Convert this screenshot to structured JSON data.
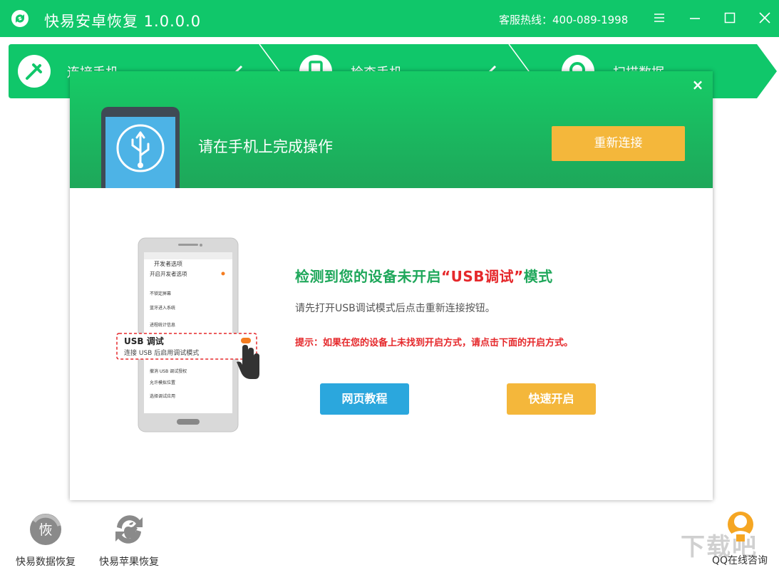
{
  "app": {
    "title": "快易安卓恢复 1.0.0.0",
    "hotline": "客服热线：400-089-1998"
  },
  "colors": {
    "brand_green": "#10c76a",
    "accent_orange": "#f4b73b",
    "accent_blue": "#2ba7dd",
    "alert_red": "#e5282b"
  },
  "window_controls": [
    "menu-icon",
    "minimize-icon",
    "maximize-icon",
    "close-icon"
  ],
  "steps": [
    {
      "label": "连接手机",
      "icon": "plug-icon",
      "done": true
    },
    {
      "label": "检查手机",
      "icon": "phone-icon",
      "done": true
    },
    {
      "label": "扫描数据",
      "icon": "magnifier-icon",
      "done": false
    }
  ],
  "dialog": {
    "close": "×",
    "header_text": "请在手机上完成操作",
    "reconnect_button": "重新连接",
    "title_prefix": "检测到您的设备未开启",
    "title_highlight": "“USB调试”",
    "title_suffix": "模式",
    "description": "请先打开USB调试模式后点击重新连接按钮。",
    "tip": "提示：如果在您的设备上未找到开启方式，请点击下面的开启方式。",
    "web_tutorial_button": "网页教程",
    "quick_enable_button": "快速开启",
    "phone_screen": {
      "header": "开发者选项",
      "row1": "开启开发者选项",
      "popup_title": "USB 调试",
      "popup_sub": "连接 USB 后启用调试模式",
      "row_a": "不锁定屏幕",
      "row_b": "蓝牙进入系统",
      "row_c": "进程统计信息",
      "row_d": "撤消 USB 调试授权",
      "row_e": "允许模拟位置",
      "row_f": "选择调试应用"
    }
  },
  "bottom": {
    "data_recovery": {
      "label": "快易数据恢复",
      "badge": "恢"
    },
    "apple_recovery": {
      "label": "快易苹果恢复"
    },
    "qq_consult": {
      "label": "QQ在线咨询"
    }
  },
  "watermark": "下载吧"
}
